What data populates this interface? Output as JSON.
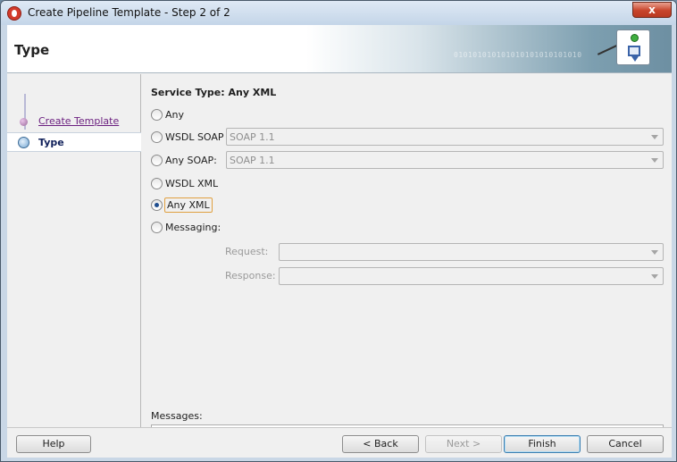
{
  "window": {
    "title": "Create Pipeline Template - Step 2 of 2",
    "close_label": "x"
  },
  "banner": {
    "page_title": "Type",
    "binary_text": "010101010101010101010101010",
    "icon": "pipeline-template-icon"
  },
  "nav": {
    "items": [
      {
        "label": "Create Template",
        "state": "visited"
      },
      {
        "label": "Type",
        "state": "active"
      }
    ]
  },
  "main": {
    "service_type_label": "Service Type: Any XML",
    "options": [
      {
        "label": "Any",
        "checked": false
      },
      {
        "label": "WSDL SOAP",
        "checked": false
      },
      {
        "label": "Any SOAP:",
        "checked": false
      },
      {
        "label": "WSDL XML",
        "checked": false
      },
      {
        "label": "Any XML",
        "checked": true
      },
      {
        "label": "Messaging:",
        "checked": false
      }
    ],
    "wsdl_soap_version": "SOAP 1.1",
    "any_soap_version": "SOAP 1.1",
    "request_label": "Request:",
    "request_value": "",
    "response_label": "Response:",
    "response_value": "",
    "messages_label": "Messages:",
    "messages_value": ""
  },
  "footer": {
    "help": "Help",
    "back": "< Back",
    "next": "Next >",
    "finish": "Finish",
    "cancel": "Cancel"
  },
  "colors": {
    "accent": "#3c7fb1",
    "nav_link": "#6b1f7f",
    "close_button": "#c8442b"
  }
}
